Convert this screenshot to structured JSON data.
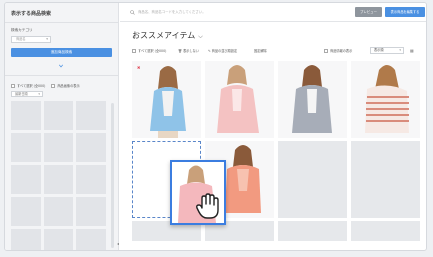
{
  "sidebar": {
    "title": "表示する商品検索",
    "category_label": "検索カテゴリ",
    "category_placeholder": "商品名",
    "search_button": "追加商品検索",
    "select_all": "すべて選択 (全000)",
    "show_only_image": "商品画像の表示",
    "sort_label": "最新日順"
  },
  "topbar": {
    "search_placeholder": "商品名、商品名コードを入力してください。",
    "preview_label": "プレビュー",
    "edit_label": "表示商品を編集する"
  },
  "main": {
    "title": "おススメアイテム",
    "toolbar": {
      "select_all": "すべて選択 (全000)",
      "show_hidden": "表示しない",
      "bulk_edit": "商品の並び順設定",
      "display_settings": "固定解除",
      "show_images": "商品情報の表示",
      "sort_select": "表示順"
    }
  },
  "colors": {
    "accent": "#4a90e2",
    "preview_button": "#8e959d",
    "drag_border": "#3b7de0"
  }
}
